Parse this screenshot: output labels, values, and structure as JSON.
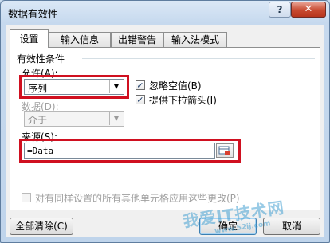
{
  "window": {
    "title": "数据有效性",
    "help_glyph": "?",
    "close_glyph": "✕"
  },
  "tabs": [
    {
      "label": "设置",
      "active": true
    },
    {
      "label": "输入信息",
      "active": false
    },
    {
      "label": "出错警告",
      "active": false
    },
    {
      "label": "输入法模式",
      "active": false
    }
  ],
  "settings": {
    "section_title": "有效性条件",
    "allow": {
      "label": "允许(A):",
      "value": "序列"
    },
    "data": {
      "label": "数据(D):",
      "value": "介于"
    },
    "ignore_blank": {
      "label": "忽略空值(B)",
      "checked": true
    },
    "dropdown": {
      "label": "提供下拉箭头(I)",
      "checked": true
    },
    "source": {
      "label": "来源(S):",
      "value": "=Data"
    },
    "apply_all": {
      "label": "对有同样设置的所有其他单元格应用这些更改(P)",
      "checked": false
    }
  },
  "buttons": {
    "clear_all": "全部清除(C)",
    "ok": "确定",
    "cancel": "取消"
  },
  "watermark": {
    "text": "我爱IT技术网",
    "sub": "www.52ij.com"
  },
  "colors": {
    "highlight_box": "#d01020",
    "title_bar": "#c6d9ee"
  }
}
